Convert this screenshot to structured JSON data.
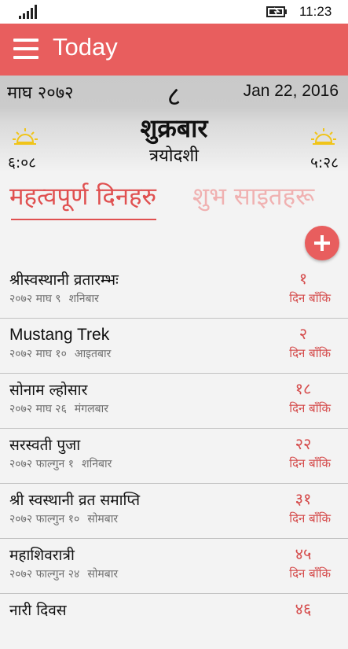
{
  "status_bar": {
    "time": "11:23",
    "signal_icon": "signal-bars-icon",
    "battery_icon": "battery-charging-icon"
  },
  "app_bar": {
    "title": "Today",
    "menu_icon": "hamburger-icon"
  },
  "date_header": {
    "nepali_month_year": "माघ २०७२",
    "day_number": "८",
    "english_date": "Jan 22, 2016",
    "weekday": "शुक्रबार",
    "tithi": "त्रयोदशी",
    "sunrise": "६:०८",
    "sunset": "५:२८",
    "sunrise_icon": "sunrise-icon",
    "sunset_icon": "sunset-icon"
  },
  "tabs": [
    {
      "label": "महत्वपूर्ण दिनहरु",
      "active": true
    },
    {
      "label": "शुभ साइतहरू",
      "active": false
    }
  ],
  "add_button_icon": "plus-icon",
  "events": [
    {
      "title": "श्रीस्वस्थानी व्रतारम्भः",
      "date": "२०७२ माघ ९",
      "weekday": "शनिबार",
      "days_left": "१",
      "unit": "दिन बाँकि"
    },
    {
      "title": "Mustang Trek",
      "date": "२०७२ माघ १०",
      "weekday": "आइतबार",
      "days_left": "२",
      "unit": "दिन बाँकि"
    },
    {
      "title": "सोनाम ल्होसार",
      "date": "२०७२ माघ २६",
      "weekday": "मंगलबार",
      "days_left": "१८",
      "unit": "दिन बाँकि"
    },
    {
      "title": "सरस्वती पुजा",
      "date": "२०७२ फाल्गुन १",
      "weekday": "शनिबार",
      "days_left": "२२",
      "unit": "दिन बाँकि"
    },
    {
      "title": "श्री स्वस्थानी व्रत समाप्ति",
      "date": "२०७२ फाल्गुन १०",
      "weekday": "सोमबार",
      "days_left": "३१",
      "unit": "दिन बाँकि"
    },
    {
      "title": "महाशिवरात्री",
      "date": "२०७२ फाल्गुन २४",
      "weekday": "सोमबार",
      "days_left": "४५",
      "unit": "दिन बाँकि"
    },
    {
      "title": "नारी दिवस",
      "date": "",
      "weekday": "",
      "days_left": "४६",
      "unit": ""
    }
  ],
  "colors": {
    "accent": "#e85e5e",
    "count_text": "#d54b4b",
    "inactive_tab": "#f0b1b1"
  }
}
